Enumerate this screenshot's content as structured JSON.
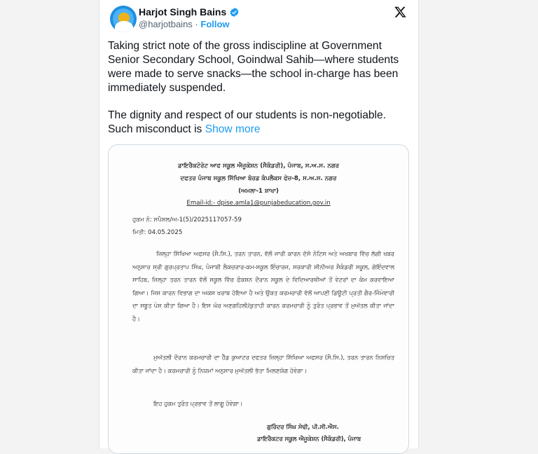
{
  "tweet": {
    "author_name": "Harjot Singh Bains",
    "handle": "@harjotbains",
    "separator": "·",
    "follow_label": "Follow",
    "text_paragraph_1": "Taking strict note of the gross indiscipline at Government Senior Secondary School, Goindwal Sahib—where students were made to serve snacks—the school in-charge has been immediately suspended.",
    "text_paragraph_2": "The dignity and respect of our students is non-negotiable. Such misconduct is",
    "show_more_label": "Show more"
  },
  "document": {
    "header_line_1": "ਡਾਇਰੈਕਟੋਰੇਟ ਆਫ ਸਕੂਲ ਐਜੂਕੇਸ਼ਨ (ਸੈਕੰਡਰੀ), ਪੰਜਾਬ, ਸ.ਅ.ਸ. ਨਗਰ",
    "header_line_2": "ਦਫਤਰ ਪੰਜਾਬ ਸਕੂਲ ਸਿੱਖਿਆ ਬੋਰਡ ਕੰਪਲੈਕਸ ਫੇਜ਼-8, ਸ.ਅ.ਸ. ਨਗਰ",
    "header_line_3": "(ਅਮਲਾ-1 ਸ਼ਾਖਾ)",
    "email": "Email-id:- dpise.amla1@punjabeducation.gov.in",
    "order_no": "ਹੁਕਮ ਨੰ: ਸਪੈਸ਼ਲ/ਅ-1(5)/2025117057-59",
    "date": "ਮਿਤੀ: 04.05.2025",
    "paragraph_1": "ਜ਼ਿਲ੍ਹਾ ਸਿੱਖਿਆ ਅਫਸਰ (ਸੈ.ਸਿ.), ਤਰਨ ਤਾਰਨ, ਵੱਲੋਂ ਜਾਰੀ ਕਾਰਨ ਦੱਸੋ ਨੋਟਿਸ ਅਤੇ ਅਖਬਾਰ ਵਿੱਚ ਲੱਗੀ ਖਬਰ ਅਨੁਸਾਰ ਸ੍ਰੀ ਗੁਰਪ੍ਰਤਾਪ ਸਿੰਘ, ਪੰਜਾਬੀ ਲੈਕਚਰਾਰ-ਕਮ-ਸਕੂਲ ਇੰਚਾਰਜ, ਸਰਕਾਰੀ ਸੀਨੀਅਰ ਸੈਕੰਡਰੀ ਸਕੂਲ, ਗੋਇੰਦਵਾਲ ਸਾਹਿਬ, ਜ਼ਿਲ੍ਹਾ ਤਰਨ ਤਾਰਨ ਵੱਲੋਂ ਸਕੂਲ ਵਿੱਚ ਫੰਕਸ਼ਨ ਦੌਰਾਨ ਸਕੂਲ ਦੇ ਵਿਦਿਆਰਥੀਆਂ ਤੋਂ ਵੇਟਰਾਂ ਦਾ ਕੰਮ ਕਰਵਾਇਆ ਗਿਆ। ਜਿਸ ਕਾਰਨ ਵਿਭਾਗ ਦਾ ਅਕਸ ਖਰਾਬ ਹੋਇਆ ਹੈ ਅਤੇ ਉਕਤ ਕਰਮਚਾਰੀ ਵੱਲੋਂ ਆਪਣੀ ਡਿਊਟੀ ਪ੍ਰਤੀ ਗੈਰ-ਜਿੰਮੇਵਾਰੀ ਦਾ ਸਬੂਤ ਪੇਸ਼ ਕੀਤਾ ਗਿਆ ਹੈ। ਇਸ ਘੋਰ ਅਣਗਹਿਲੀ/ਕੁਤਾਹੀ ਕਾਰਨ ਕਰਮਚਾਰੀ ਨੂੰ ਤੁਰੰਤ ਪ੍ਰਭਾਵ ਤੋਂ ਮੁਅੱਤਲ ਕੀਤਾ ਜਾਂਦਾ ਹੈ।",
    "paragraph_2": "ਮੁਅੱਤਲੀ ਦੌਰਾਨ ਕਰਮਚਾਰੀ ਦਾ ਹੈੱਡ ਕੁਆਟਰ ਦਫਤਰ ਜ਼ਿਲ੍ਹਾ ਸਿੱਖਿਆ ਅਫਸਰ (ਸੈ.ਸਿ.), ਤਰਨ ਤਾਰਨ ਨਿਸ਼ਚਿਤ ਕੀਤਾ ਜਾਂਦਾ ਹੈ। ਕਰਮਚਾਰੀ ਨੂੰ ਨਿਯਮਾਂ ਅਨੁਸਾਰ ਮੁਅੱਤਲੀ ਭੱਤਾ ਮਿਲਣਯੋਗ ਹੋਵੇਗਾ।",
    "paragraph_3": "ਇਹ ਹੁਕਮ ਤੁਰੰਤ ਪ੍ਰਭਾਵ ਤੋਂ ਲਾਗੂ ਹੋਵੇਗਾ।",
    "signature_name": "ਗੁਰਿੰਦਰ ਸਿੰਘ ਸੋਢੀ, ਪੀ.ਸੀ.ਐਸ.",
    "signature_title": "ਡਾਇਰੈਕਟਰ ਸਕੂਲ ਐਜੂਕੇਸ਼ਨ (ਸੈਕੰਡਰੀ), ਪੰਜਾਬ"
  },
  "colors": {
    "link": "#1d9bf0",
    "text": "#0f1419",
    "muted": "#536471",
    "page_bg": "#f3f3f3"
  }
}
